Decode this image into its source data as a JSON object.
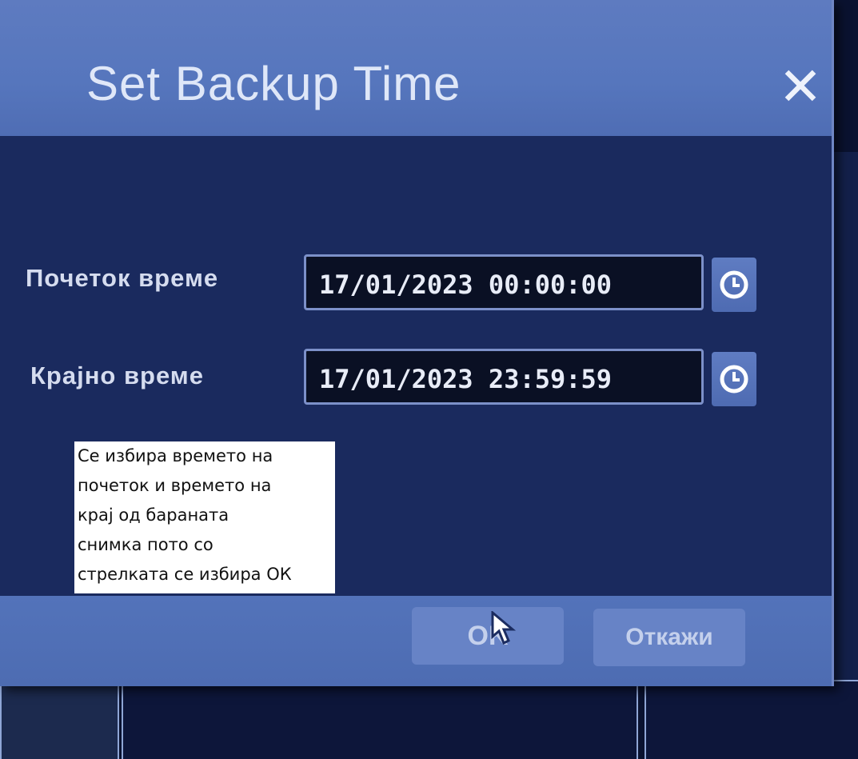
{
  "dialog": {
    "title": "Set Backup Time",
    "close_symbol": "✕"
  },
  "fields": [
    {
      "label": "Почеток време",
      "value": "17/01/2023 00:00:00",
      "icon": "clock-icon"
    },
    {
      "label": "Крајно време",
      "value": "17/01/2023 23:59:59",
      "icon": "clock-icon"
    }
  ],
  "buttons": {
    "ok_label": "OK",
    "cancel_label": "Откажи"
  },
  "annotation": {
    "lines": [
      "Се избира времето на",
      "почеток и времето на",
      "крај од бараната",
      "снимка пото со",
      "стрелката се избира ОК"
    ]
  },
  "colors": {
    "title_bar": "#5676bd",
    "dialog_body": "#1a2a5e",
    "input_bg": "#0a1024",
    "button": "#6783c6"
  }
}
